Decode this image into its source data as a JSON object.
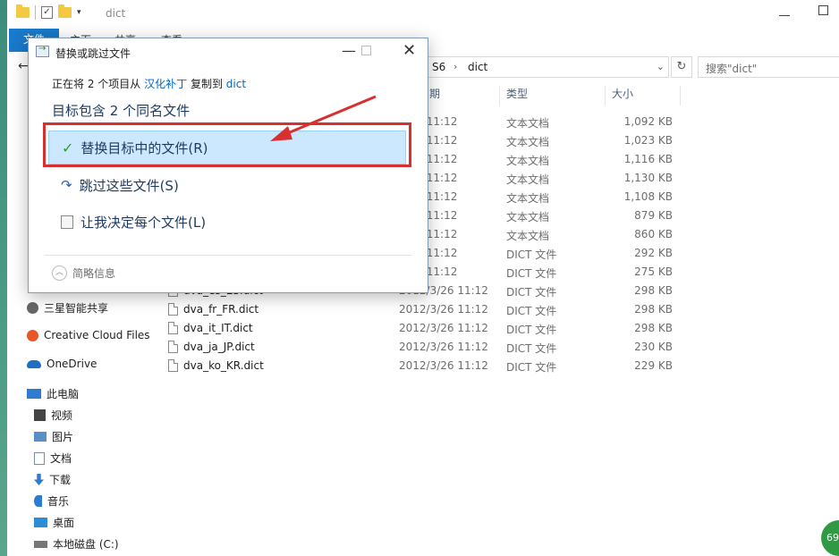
{
  "window": {
    "title": "dict",
    "ribbon_file_tab": "文件",
    "ribbon_tabs": [
      "主页",
      "共享",
      "查看"
    ]
  },
  "address": {
    "crumbs": [
      "S6",
      "dict"
    ],
    "search_placeholder": "搜索\"dict\""
  },
  "columns": {
    "date": "期",
    "type": "类型",
    "size": "大小"
  },
  "files": [
    {
      "name": "",
      "date": "3/26 11:12",
      "type": "文本文档",
      "size": "1,092 KB"
    },
    {
      "name": "",
      "date": "3/26 11:12",
      "type": "文本文档",
      "size": "1,023 KB"
    },
    {
      "name": "",
      "date": "3/26 11:12",
      "type": "文本文档",
      "size": "1,116 KB"
    },
    {
      "name": "",
      "date": "3/26 11:12",
      "type": "文本文档",
      "size": "1,130 KB"
    },
    {
      "name": "",
      "date": "3/26 11:12",
      "type": "文本文档",
      "size": "1,108 KB"
    },
    {
      "name": "",
      "date": "3/26 11:12",
      "type": "文本文档",
      "size": "879 KB"
    },
    {
      "name": "",
      "date": "3/26 11:12",
      "type": "文本文档",
      "size": "860 KB"
    },
    {
      "name": "",
      "date": "3/26 11:12",
      "type": "DICT 文件",
      "size": "292 KB"
    },
    {
      "name": "",
      "date": "3/26 11:12",
      "type": "DICT 文件",
      "size": "275 KB"
    },
    {
      "name": "dva_es_ES.dict",
      "date": "2012/3/26 11:12",
      "type": "DICT 文件",
      "size": "298 KB"
    },
    {
      "name": "dva_fr_FR.dict",
      "date": "2012/3/26 11:12",
      "type": "DICT 文件",
      "size": "298 KB"
    },
    {
      "name": "dva_it_IT.dict",
      "date": "2012/3/26 11:12",
      "type": "DICT 文件",
      "size": "298 KB"
    },
    {
      "name": "dva_ja_JP.dict",
      "date": "2012/3/26 11:12",
      "type": "DICT 文件",
      "size": "230 KB"
    },
    {
      "name": "dva_ko_KR.dict",
      "date": "2012/3/26 11:12",
      "type": "DICT 文件",
      "size": "229 KB"
    }
  ],
  "nav": {
    "items": [
      {
        "label": "三星智能共享",
        "icon": "samsung-share-icon"
      },
      {
        "label": "Creative Cloud Files",
        "icon": "creative-cloud-icon"
      },
      {
        "label": "OneDrive",
        "icon": "onedrive-icon"
      },
      {
        "label": "此电脑",
        "icon": "computer-icon"
      },
      {
        "label": "视频",
        "icon": "video-icon"
      },
      {
        "label": "图片",
        "icon": "pictures-icon"
      },
      {
        "label": "文档",
        "icon": "documents-icon"
      },
      {
        "label": "下载",
        "icon": "download-icon"
      },
      {
        "label": "音乐",
        "icon": "music-icon"
      },
      {
        "label": "桌面",
        "icon": "desktop-icon"
      },
      {
        "label": "本地磁盘 (C:)",
        "icon": "drive-icon"
      }
    ]
  },
  "dialog": {
    "title": "替换或跳过文件",
    "line1_prefix": "正在将 2 个项目从",
    "line1_source": "汉化补丁",
    "line1_mid": "复制到",
    "line1_dest": "dict",
    "line2": "目标包含 2 个同名文件",
    "opt_replace": "替换目标中的文件(R)",
    "opt_skip": "跳过这些文件(S)",
    "opt_decide": "让我决定每个文件(L)",
    "details": "简略信息"
  },
  "badge": "69",
  "colors": {
    "accent": "#1979ca",
    "highlight": "#cce8ff",
    "annotation": "#d7302e"
  }
}
